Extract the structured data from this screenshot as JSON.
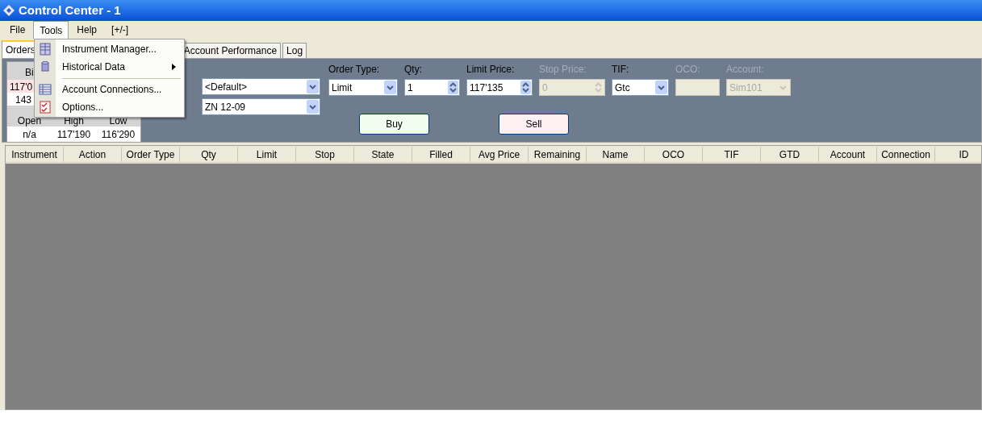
{
  "window": {
    "title": "Control Center - 1"
  },
  "menu_bar": [
    {
      "label": "File",
      "selected": false
    },
    {
      "label": "Tools",
      "selected": true
    },
    {
      "label": "Help",
      "selected": false
    },
    {
      "label": "[+/-]",
      "selected": false
    }
  ],
  "tools_menu": [
    {
      "kind": "item",
      "label": "Instrument Manager...",
      "submenu": false
    },
    {
      "kind": "item",
      "label": "Historical Data",
      "submenu": true
    },
    {
      "kind": "separator"
    },
    {
      "kind": "item",
      "label": "Account Connections...",
      "submenu": false
    },
    {
      "kind": "item",
      "label": "Options...",
      "submenu": false
    }
  ],
  "tabs": [
    {
      "label": "Orders",
      "selected": true
    },
    {
      "label": "Account Performance",
      "selected": false
    },
    {
      "label": "Log",
      "selected": false
    }
  ],
  "quote": {
    "bid_header": "Bi",
    "bid_price": "117'0",
    "bid_size": "143",
    "stats_header": [
      "Open",
      "High",
      "Low"
    ],
    "stats_values": [
      "n/a",
      "117'190",
      "116'290"
    ]
  },
  "order_entry": {
    "account_dropdown": "<Default>",
    "instrument_dropdown": "ZN 12-09",
    "fields": [
      {
        "label": "Order Type:",
        "kind": "dropdown",
        "value": "Limit",
        "disabled": false
      },
      {
        "label": "Qty:",
        "kind": "spinner",
        "value": "1",
        "disabled": false
      },
      {
        "label": "Limit Price:",
        "kind": "spinner",
        "value": "117'135",
        "disabled": false
      },
      {
        "label": "Stop Price:",
        "kind": "spinner",
        "value": "0",
        "disabled": true
      },
      {
        "label": "TIF:",
        "kind": "dropdown",
        "value": "Gtc",
        "disabled": false
      },
      {
        "label": "OCO:",
        "kind": "text",
        "disabled": true
      },
      {
        "label": "Account:",
        "kind": "dropdown",
        "value": "Sim101",
        "disabled": true
      }
    ],
    "buttons": [
      {
        "label": "Buy",
        "kind": "buy"
      },
      {
        "label": "Sell",
        "kind": "sell"
      }
    ]
  },
  "table": {
    "columns": [
      "Instrument",
      "Action",
      "Order Type",
      "Qty",
      "Limit",
      "Stop",
      "State",
      "Filled",
      "Avg Price",
      "Remaining",
      "Name",
      "OCO",
      "TIF",
      "GTD",
      "Account",
      "Connection",
      "ID"
    ]
  }
}
